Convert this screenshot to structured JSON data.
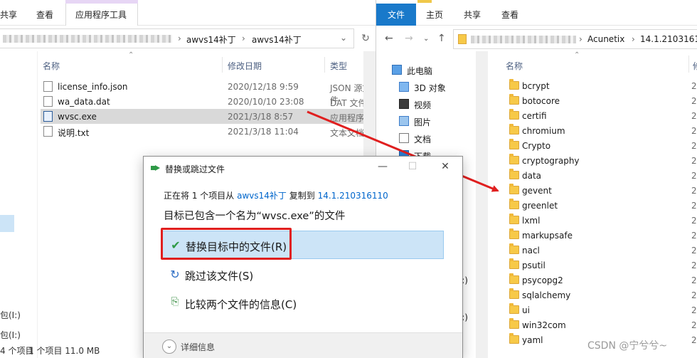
{
  "left": {
    "ribbon_tabs": [
      "共享",
      "查看"
    ],
    "tools_tab": "应用程序工具",
    "breadcrumb": [
      "awvs14补丁",
      "awvs14补丁"
    ],
    "breadcrumb_sep": "›",
    "columns": {
      "name": "名称",
      "date": "修改日期",
      "type": "类型"
    },
    "files": [
      {
        "name": "license_info.json",
        "date": "2020/12/18 9:59",
        "type": "JSON 源文件",
        "icon": "json-file-icon"
      },
      {
        "name": "wa_data.dat",
        "date": "2020/10/10 23:08",
        "type": "DAT 文件",
        "icon": "generic-file-icon"
      },
      {
        "name": "wvsc.exe",
        "date": "2021/3/18 8:57",
        "type": "应用程序",
        "icon": "exe-file-icon",
        "selected": true
      },
      {
        "name": "说明.txt",
        "date": "2021/3/18 11:04",
        "type": "文本文档",
        "icon": "text-file-icon"
      }
    ],
    "status": {
      "items": "4 个项目",
      "selected": "1 个项目 11.0 MB",
      "nav_fragment_1": "包(I:)",
      "nav_fragment_2": "包(I:)"
    }
  },
  "right": {
    "ribbon_tabs": [
      "文件",
      "主页",
      "共享",
      "查看"
    ],
    "breadcrumb": [
      "Acunetix",
      "14.1.210316110"
    ],
    "breadcrumb_sep": "›",
    "nav_tree": [
      {
        "label": "此电脑",
        "icon": "computer-icon"
      },
      {
        "label": "3D 对象",
        "icon": "3d-objects-icon"
      },
      {
        "label": "视频",
        "icon": "video-icon"
      },
      {
        "label": "图片",
        "icon": "pictures-icon"
      },
      {
        "label": "文档",
        "icon": "documents-icon"
      },
      {
        "label": "下载",
        "icon": "download-icon"
      }
    ],
    "columns": {
      "name": "名称",
      "date": "修"
    },
    "folders": [
      "bcrypt",
      "botocore",
      "certifi",
      "chromium",
      "Crypto",
      "cryptography",
      "data",
      "gevent",
      "greenlet",
      "lxml",
      "markupsafe",
      "nacl",
      "psutil",
      "psycopg2",
      "sqlalchemy",
      "ui",
      "win32com",
      "yaml"
    ],
    "folder_date_prefix": "2",
    "nav_fragment": "包(I:)"
  },
  "dialog": {
    "title": "替换或跳过文件",
    "progress_prefix": "正在将 1 个项目从",
    "source": "awvs14补丁",
    "progress_mid": "复制到",
    "destination": "14.1.210316110",
    "heading": "目标已包含一个名为“wvsc.exe”的文件",
    "options": [
      {
        "label": "替换目标中的文件(R)",
        "icon": "checkmark-icon"
      },
      {
        "label": "跳过该文件(S)",
        "icon": "skip-icon"
      },
      {
        "label": "比较两个文件的信息(C)",
        "icon": "compare-icon"
      }
    ],
    "details": "详细信息"
  },
  "watermark": "CSDN @宁兮兮~",
  "colors": {
    "accent": "#1979ca",
    "selection": "#cce4f7",
    "annotation": "#e01f1f",
    "folder": "#f7c948",
    "link": "#0066cc"
  }
}
